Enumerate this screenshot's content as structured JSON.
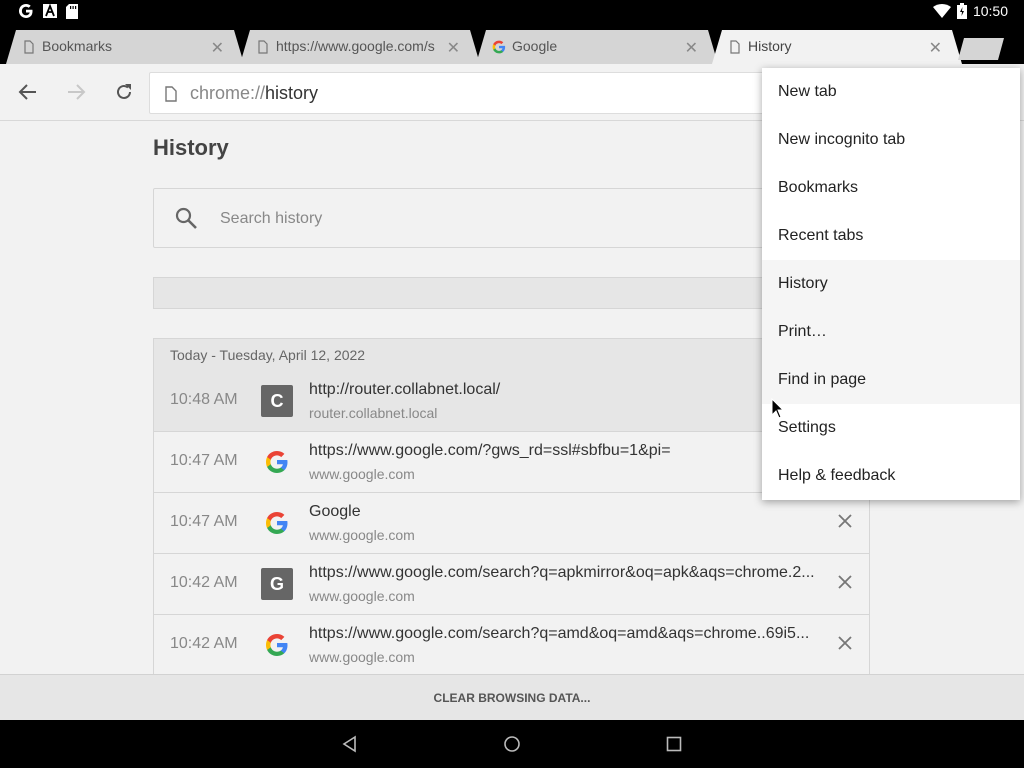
{
  "status_bar": {
    "time": "10:50",
    "left_icons": [
      "google-icon",
      "a-icon",
      "sd-card-icon"
    ],
    "right_icons": [
      "wifi-icon",
      "battery-icon"
    ]
  },
  "tabs": [
    {
      "title": "Bookmarks",
      "icon": "page-icon",
      "active": false
    },
    {
      "title": "https://www.google.com/s",
      "icon": "page-icon",
      "active": false
    },
    {
      "title": "Google",
      "icon": "google-g-icon",
      "active": false
    },
    {
      "title": "History",
      "icon": "page-icon",
      "active": true
    }
  ],
  "toolbar": {
    "url_scheme": "chrome://",
    "url_path": "history"
  },
  "page": {
    "title": "History",
    "search_placeholder": "Search history",
    "day_header": "Today - Tuesday, April 12, 2022"
  },
  "history": [
    {
      "time": "10:48 AM",
      "favicon": "C",
      "title": "http://router.collabnet.local/",
      "domain": "router.collabnet.local"
    },
    {
      "time": "10:47 AM",
      "favicon": "google",
      "title": "https://www.google.com/?gws_rd=ssl#sbfbu=1&pi=",
      "domain": "www.google.com"
    },
    {
      "time": "10:47 AM",
      "favicon": "google",
      "title": "Google",
      "domain": "www.google.com"
    },
    {
      "time": "10:42 AM",
      "favicon": "G",
      "title": "https://www.google.com/search?q=apkmirror&oq=apk&aqs=chrome.2...",
      "domain": "www.google.com"
    },
    {
      "time": "10:42 AM",
      "favicon": "google",
      "title": "https://www.google.com/search?q=amd&oq=amd&aqs=chrome..69i5...",
      "domain": "www.google.com"
    }
  ],
  "clear_button": "CLEAR BROWSING DATA...",
  "menu": {
    "items": [
      "New tab",
      "New incognito tab",
      "Bookmarks",
      "Recent tabs",
      "History",
      "Print…",
      "Find in page",
      "Settings",
      "Help & feedback"
    ]
  },
  "colors": {
    "google_blue": "#4285F4",
    "google_red": "#EA4335",
    "google_yellow": "#FBBC05",
    "google_green": "#34A853"
  }
}
